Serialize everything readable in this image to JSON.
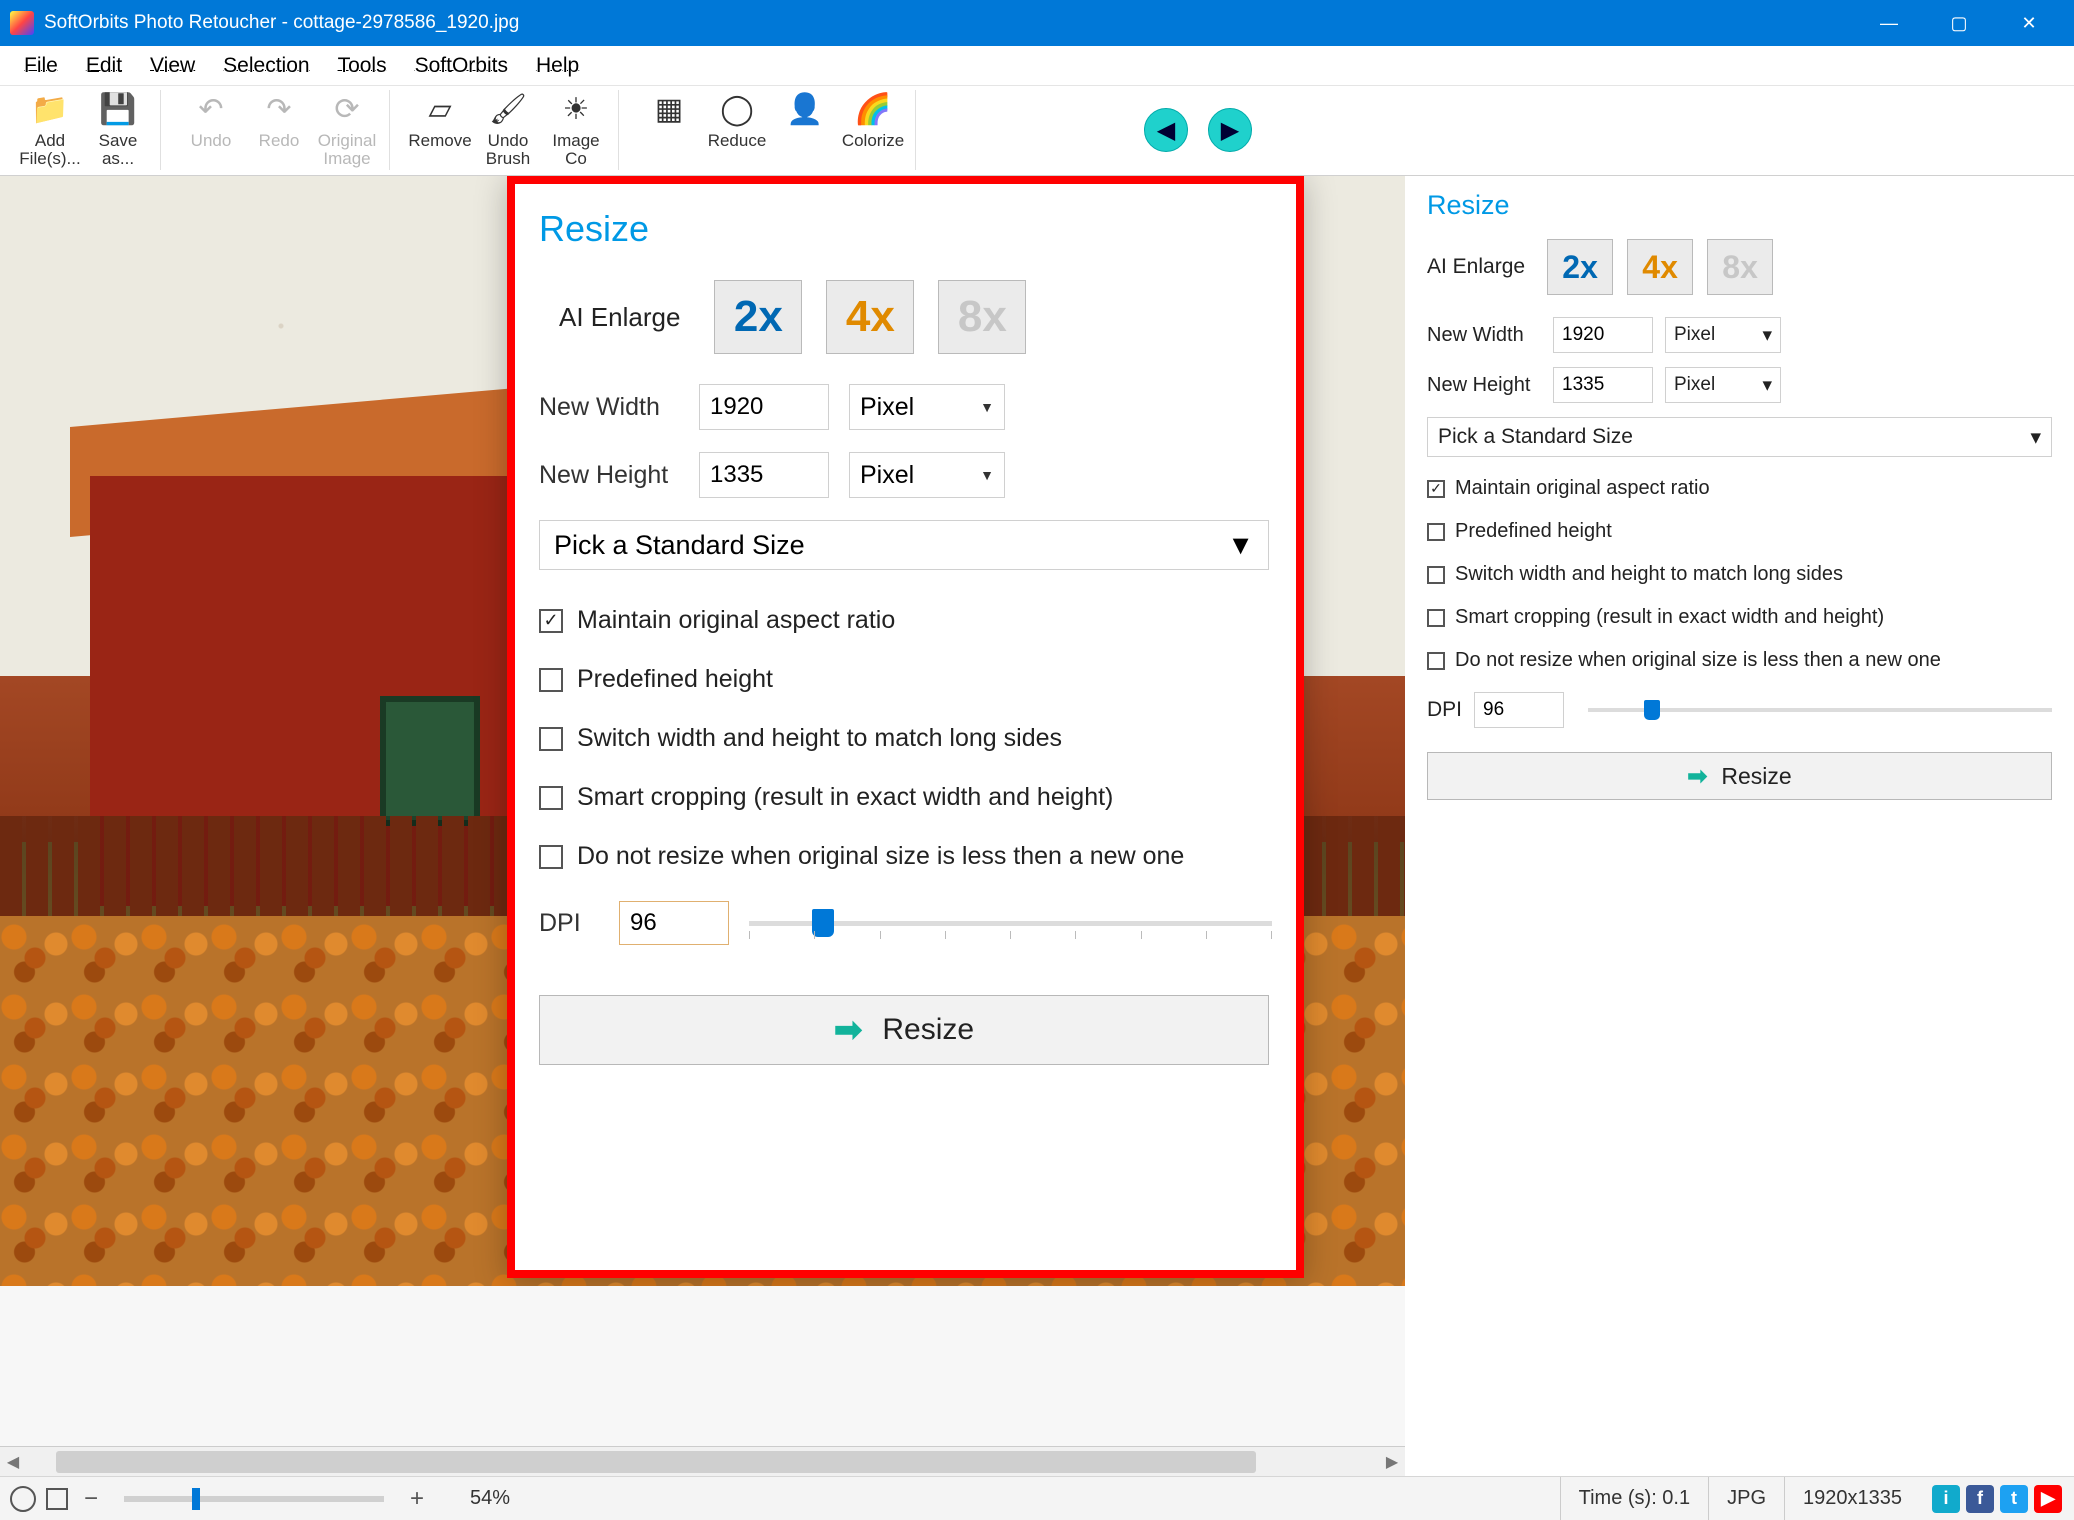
{
  "window": {
    "title": "SoftOrbits Photo Retoucher - cottage-2978586_1920.jpg",
    "minimize": "—",
    "maximize": "▢",
    "close": "✕"
  },
  "menu": {
    "items": [
      "File",
      "Edit",
      "View",
      "Selection",
      "Tools",
      "SoftOrbits",
      "Help"
    ]
  },
  "toolbar": {
    "groups": [
      [
        {
          "label": "Add\nFile(s)...",
          "icon": "📁"
        },
        {
          "label": "Save\nas...",
          "icon": "💾"
        }
      ],
      [
        {
          "label": "Undo",
          "icon": "↶",
          "disabled": true
        },
        {
          "label": "Redo",
          "icon": "↷",
          "disabled": true
        },
        {
          "label": "Original\nImage",
          "icon": "⟳",
          "disabled": true
        }
      ],
      [
        {
          "label": "Remove",
          "icon": "▱"
        },
        {
          "label": "Undo\nBrush",
          "icon": "🖌"
        },
        {
          "label": "Image\nCo",
          "icon": "☀"
        }
      ],
      [
        {
          "label": "",
          "icon": "▦"
        },
        {
          "label": "Reduce",
          "icon": "◯"
        },
        {
          "label": "",
          "icon": "👤"
        },
        {
          "label": "Colorize",
          "icon": "🌈"
        }
      ]
    ]
  },
  "resize_panel": {
    "title": "Resize",
    "ai_label": "AI Enlarge",
    "ai_options": [
      "2x",
      "4x",
      "8x"
    ],
    "width_label": "New Width",
    "width_value": "1920",
    "height_label": "New Height",
    "height_value": "1335",
    "unit": "Pixel",
    "standard_size": "Pick a Standard Size",
    "checks": [
      {
        "label": "Maintain original aspect ratio",
        "checked": true
      },
      {
        "label": "Predefined height",
        "checked": false
      },
      {
        "label": "Switch width and height to match long sides",
        "checked": false
      },
      {
        "label": "Smart cropping (result in exact width and height)",
        "checked": false
      },
      {
        "label": "Do not resize when original size is less then a new one",
        "checked": false
      }
    ],
    "dpi_label": "DPI",
    "dpi_value": "96",
    "button": "Resize"
  },
  "status": {
    "zoom_pct": "54%",
    "time": "Time (s): 0.1",
    "format": "JPG",
    "dims": "1920x1335"
  }
}
